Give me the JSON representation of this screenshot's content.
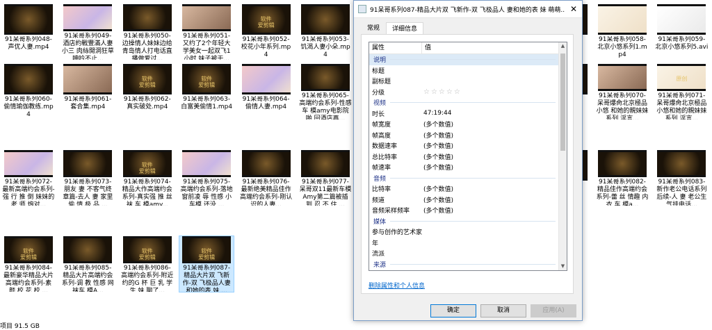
{
  "files": [
    {
      "name": "91呆哥系列048-声优人妻.mp4",
      "thumb": "dark",
      "logo": ""
    },
    {
      "name": "91呆哥系列049-酒店約戰豐滿人妻小三 肉絲開洞狂草呻吟不止...",
      "thumb": "pink",
      "logo": ""
    },
    {
      "name": "91呆哥系列050-边操情人妹妹边给青岛情人打电话直播做爱过...",
      "thumb": "dark",
      "logo": ""
    },
    {
      "name": "91呆哥系列051-又约了2个年轻大学美女一起双飞1小时 妹子被干...",
      "thumb": "skin",
      "logo": ""
    },
    {
      "name": "91呆哥系列052-校花小年系列.mp4",
      "thumb": "dark",
      "logo": "软件\n爱剪辑"
    },
    {
      "name": "91呆哥系列053-饥渴人妻小朵.mp4",
      "thumb": "dark",
      "logo": ""
    },
    {
      "name": "",
      "thumb": "dark",
      "logo": ""
    },
    {
      "name": "",
      "thumb": "dark",
      "logo": ""
    },
    {
      "name": "",
      "thumb": "dark",
      "logo": ""
    },
    {
      "name": "",
      "thumb": "dark",
      "logo": ""
    },
    {
      "name": "91呆哥系列058-北京小悠系列1.mp4",
      "thumb": "cream",
      "logo": ""
    },
    {
      "name": "91呆哥系列059-北京小悠系列5.avi",
      "thumb": "white",
      "logo": ""
    },
    {
      "name": "91呆哥系列060-偷情瑜伽教练.mp4",
      "thumb": "dark",
      "logo": ""
    },
    {
      "name": "91呆哥系列061-套合集.mp4",
      "thumb": "skin",
      "logo": ""
    },
    {
      "name": "91呆哥系列062-真实破处.mp4",
      "thumb": "dark",
      "logo": "软件\n爱剪辑"
    },
    {
      "name": "91呆哥系列063-白富美偷情1.mp4",
      "thumb": "dark",
      "logo": "软件\n爱剪辑"
    },
    {
      "name": "91呆哥系列064-偷情人妻.mp4",
      "thumb": "pink",
      "logo": ""
    },
    {
      "name": "91呆哥系列065-高端约会系列-性感 车 模amy电影院 啪 回酒店再...",
      "thumb": "dark",
      "logo": ""
    },
    {
      "name": "",
      "thumb": "dark",
      "logo": ""
    },
    {
      "name": "",
      "thumb": "dark",
      "logo": ""
    },
    {
      "name": "",
      "thumb": "dark",
      "logo": ""
    },
    {
      "name": "",
      "thumb": "dark",
      "logo": ""
    },
    {
      "name": "91呆哥系列070-呆哥爆肏北京極品小悠 和她的親妹妹系列 淫言...",
      "thumb": "skin",
      "logo": ""
    },
    {
      "name": "91呆哥系列071-呆哥爆肏北京極品小悠和她的親妹妹系列 淫言...",
      "thumb": "cream",
      "logo": "原创"
    },
    {
      "name": "91呆哥系列072-最新高端约会系列-强 行 推 倒 妹妹的老 师 炮对...",
      "thumb": "pink",
      "logo": ""
    },
    {
      "name": "91呆哥系列073-朋友 妻 不客气终章篇-去人 妻 家里 偷 情 极 品 ...",
      "thumb": "dark",
      "logo": ""
    },
    {
      "name": "91呆哥系列074-精品大作高端约会系列-真实强 推 丝 袜 车 模amy...",
      "thumb": "dark",
      "logo": "软件\n爱剪辑"
    },
    {
      "name": "91呆哥系列075-高端约会系列-落地窗前凌 辱 性感 小车模 还没 ...",
      "thumb": "pink",
      "logo": ""
    },
    {
      "name": "91呆哥系列076-最新绝美精品佳作高端约会系列-刚认识的人妻...",
      "thumb": "dark",
      "logo": ""
    },
    {
      "name": "91呆哥系列077-呆哥双11最新车模Amy第二篇被插 到 忍 不 住 ...",
      "thumb": "dark",
      "logo": ""
    },
    {
      "name": "",
      "thumb": "dark",
      "logo": ""
    },
    {
      "name": "",
      "thumb": "dark",
      "logo": ""
    },
    {
      "name": "",
      "thumb": "dark",
      "logo": ""
    },
    {
      "name": "",
      "thumb": "dark",
      "logo": ""
    },
    {
      "name": "91呆哥系列082-精品佳作高端约会系列-蕾 丝 情趣 内 衣 车 模a...",
      "thumb": "dark",
      "logo": ""
    },
    {
      "name": "91呆哥系列083-新作老公电话系列后续-人 妻 老公生气挂电话...",
      "thumb": "dark",
      "logo": ""
    },
    {
      "name": "91呆哥系列084-最新豪华精品大片高端约会系列-素 颜 校 花 校 ...",
      "thumb": "dark",
      "logo": "软件\n爱剪辑"
    },
    {
      "name": "91呆哥系列085-精品大片高端约会系列-调 教 性感 网袜车 模A...",
      "thumb": "dark",
      "logo": ""
    },
    {
      "name": "91呆哥系列086-高端约会系列-附近约的G 杯 巨 乳 学 生 妹 聊了...",
      "thumb": "dark",
      "logo": "软件\n爱剪辑"
    },
    {
      "name": "91呆哥系列087-精品大片双 飞新作-双 飞极品人妻和她的表 妹 ...",
      "thumb": "dark",
      "logo": "软件\n爱剪辑"
    }
  ],
  "status": {
    "text": "项目  91.5 GB"
  },
  "dialog": {
    "title": "91呆哥系列087-精品大片双 飞新作-双 飞极品人 妻和她的表 妹 萌萌...",
    "close_glyph": "✕",
    "tabs": [
      "常规",
      "详细信息"
    ],
    "active_tab": 1,
    "columns": {
      "name": "属性",
      "value": "值"
    },
    "rows": [
      {
        "type": "section",
        "label": "说明",
        "first": true
      },
      {
        "type": "prop",
        "k": "标题",
        "v": ""
      },
      {
        "type": "prop",
        "k": "副标题",
        "v": ""
      },
      {
        "type": "prop",
        "k": "分级",
        "v": "☆☆☆☆☆",
        "stars": true
      },
      {
        "type": "section",
        "label": "视频"
      },
      {
        "type": "prop",
        "k": "时长",
        "v": "47:19:44"
      },
      {
        "type": "prop",
        "k": "帧宽度",
        "v": "(多个数值)"
      },
      {
        "type": "prop",
        "k": "帧高度",
        "v": "(多个数值)"
      },
      {
        "type": "prop",
        "k": "数据速率",
        "v": "(多个数值)"
      },
      {
        "type": "prop",
        "k": "总比特率",
        "v": "(多个数值)"
      },
      {
        "type": "prop",
        "k": "帧速率",
        "v": "(多个数值)"
      },
      {
        "type": "section",
        "label": "音频"
      },
      {
        "type": "prop",
        "k": "比特率",
        "v": "(多个数值)"
      },
      {
        "type": "prop",
        "k": "频道",
        "v": "(多个数值)"
      },
      {
        "type": "prop",
        "k": "音频采样频率",
        "v": "(多个数值)"
      },
      {
        "type": "section",
        "label": "媒体"
      },
      {
        "type": "prop",
        "k": "参与创作的艺术家",
        "v": ""
      },
      {
        "type": "prop",
        "k": "年",
        "v": ""
      },
      {
        "type": "prop",
        "k": "流派",
        "v": ""
      },
      {
        "type": "section",
        "label": "来源"
      }
    ],
    "remove_link": "删除属性和个人信息",
    "buttons": {
      "ok": "确定",
      "cancel": "取消",
      "apply": "应用(A)"
    }
  }
}
